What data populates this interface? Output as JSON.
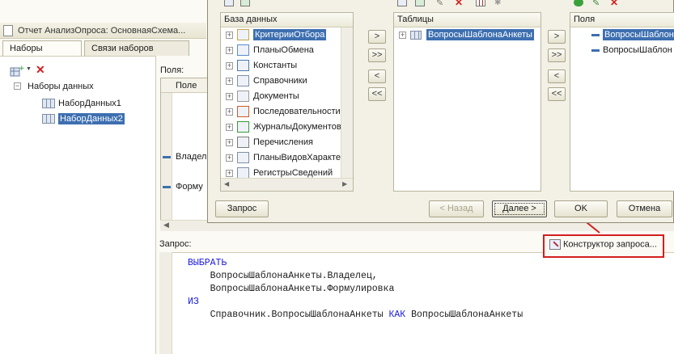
{
  "back_window": {
    "title": "Отчет АнализОпроса: ОсновнаяСхема...",
    "tabs": [
      "Наборы данных",
      "Связи наборов данных"
    ],
    "tree": {
      "root": "Наборы данных",
      "items": [
        "НаборДанных1",
        "НаборДанных2"
      ],
      "selected_index": 1
    },
    "fields_label": "Поля:",
    "fields_header": "Поле",
    "fields_rows": [
      "Владел",
      "Форму"
    ],
    "query_label": "Запрос:",
    "query": {
      "kw_select": "ВЫБРАТЬ",
      "line1": "ВопросыШаблонаАнкеты.Владелец,",
      "line2": "ВопросыШаблонаАнкеты.Формулировка",
      "kw_from": "ИЗ",
      "from_src": "Справочник.ВопросыШаблонаАнкеты",
      "kw_as": "КАК",
      "alias": "ВопросыШаблонаАнкеты"
    },
    "constructor_button": "Конструктор запроса..."
  },
  "dialog": {
    "db_header": "База данных",
    "db_items": [
      {
        "label": "КритерииОтбора",
        "icon": "filter-criteria-icon"
      },
      {
        "label": "ПланыОбмена",
        "icon": "exchange-plans-icon"
      },
      {
        "label": "Константы",
        "icon": "constants-icon"
      },
      {
        "label": "Справочники",
        "icon": "catalogs-icon"
      },
      {
        "label": "Документы",
        "icon": "documents-icon"
      },
      {
        "label": "Последовательности",
        "icon": "sequences-icon"
      },
      {
        "label": "ЖурналыДокументов",
        "icon": "document-journals-icon"
      },
      {
        "label": "Перечисления",
        "icon": "enumerations-icon"
      },
      {
        "label": "ПланыВидовХарактери",
        "icon": "characteristic-types-icon"
      },
      {
        "label": "РегистрыСведений",
        "icon": "info-registers-icon"
      }
    ],
    "tables_header": "Таблицы",
    "tables_items": [
      "ВопросыШаблонаАнкеты"
    ],
    "fields_header": "Поля",
    "fields_items": [
      "ВопросыШаблон",
      "ВопросыШаблон"
    ],
    "move_buttons": [
      ">",
      ">>",
      "<",
      "<<"
    ],
    "buttons": {
      "query": "Запрос",
      "back": "< Назад",
      "next": "Далее >",
      "ok": "OK",
      "cancel": "Отмена"
    }
  },
  "colors": {
    "selection": "#3d6fb0",
    "keyword": "#1a1adb",
    "highlight": "#d21f1f"
  }
}
